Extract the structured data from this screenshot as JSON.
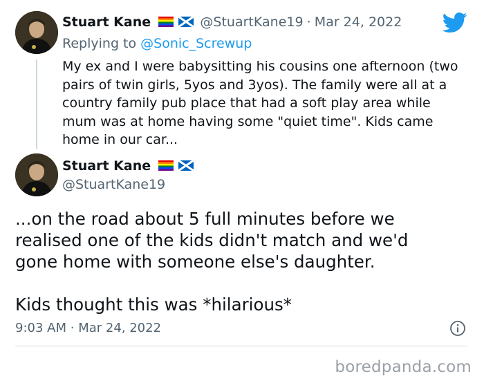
{
  "brand": {
    "twitter_color": "#1d9bf0",
    "watermark": "boredpanda.com"
  },
  "first_tweet": {
    "author_name": "Stuart Kane",
    "handle": "@StuartKane19",
    "separator": "·",
    "date": "Mar 24, 2022",
    "replying_prefix": "Replying to",
    "replying_to": "@Sonic_Screwup",
    "body_lines": [
      "My ex and I were babysitting his cousins one afternoon (two",
      "pairs of twin girls, 5yos and 3yos). The family were all at a",
      "country family pub place that had a soft play area while",
      "mum was at home having some \"quiet time\". Kids came",
      "home in our car..."
    ]
  },
  "second_tweet": {
    "author_name": "Stuart Kane",
    "handle": "@StuartKane19",
    "body_lines": [
      "...on the road about 5 full minutes before we",
      "realised one of the kids didn't match and we'd",
      "gone home with someone else's daughter."
    ],
    "body_line_final": "Kids thought this was *hilarious*",
    "time": "9:03 AM",
    "separator": "·",
    "date": "Mar 24, 2022"
  },
  "icons": {
    "logo": "twitter-bird-icon",
    "flag_1": "rainbow-flag-icon",
    "flag_2": "scotland-flag-icon",
    "info": "info-icon"
  }
}
